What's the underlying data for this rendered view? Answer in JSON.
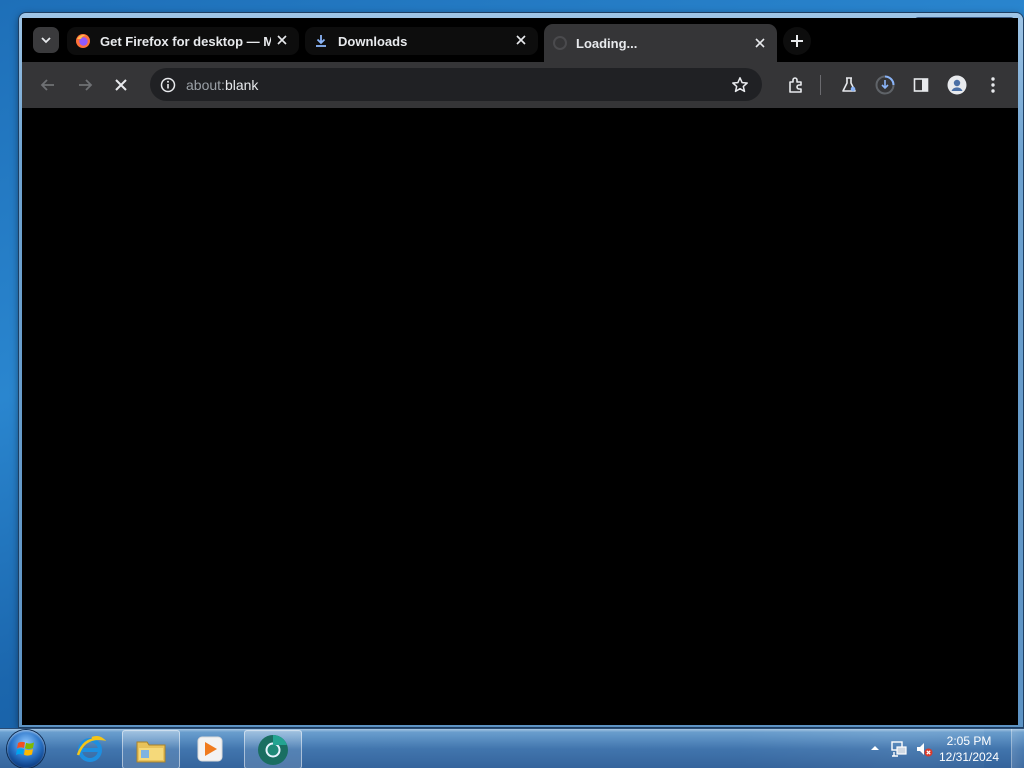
{
  "browser": {
    "tabs": [
      {
        "title": "Get Firefox for desktop — Mozilla",
        "favicon": "firefox-icon",
        "active": false
      },
      {
        "title": "Downloads",
        "favicon": "download-icon",
        "active": false
      },
      {
        "title": "Loading...",
        "favicon": "loading-icon",
        "active": true
      }
    ],
    "omnibox": {
      "url_scheme": "about:",
      "url_path": "blank"
    },
    "toolbar_icons": [
      "back-icon",
      "forward-icon",
      "stop-icon",
      "info-icon",
      "star-icon",
      "extensions-icon",
      "labs-icon",
      "downloads-icon",
      "side-panel-icon",
      "profile-icon",
      "menu-icon"
    ]
  },
  "taskbar": {
    "pinned": [
      "internet-explorer-icon",
      "file-explorer-icon",
      "media-player-icon",
      "chrome-beta-icon"
    ],
    "clock": {
      "time": "2:05 PM",
      "date": "12/31/2024"
    },
    "tray_icons": [
      "show-hidden-icons-arrow",
      "network-icon",
      "volume-muted-icon"
    ]
  },
  "colors": {
    "tab_strip": "#000000",
    "toolbar": "#353537",
    "omnibox": "#202124",
    "text": "#e8eaed"
  }
}
